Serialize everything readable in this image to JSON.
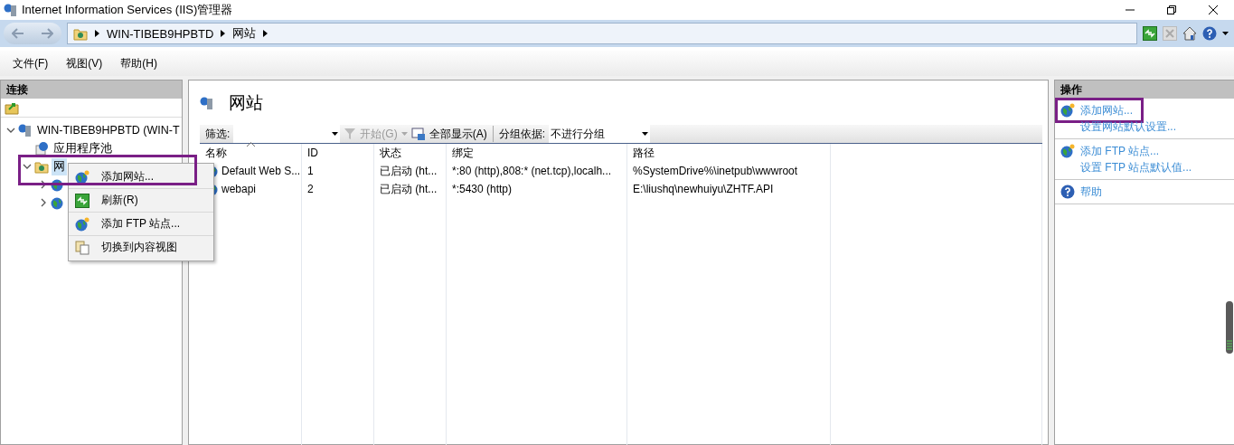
{
  "window": {
    "title": "Internet Information Services (IIS)管理器"
  },
  "address_bar": {
    "segments": [
      "WIN-TIBEB9HPBTD",
      "网站"
    ]
  },
  "menu_bar": [
    "文件(F)",
    "视图(V)",
    "帮助(H)"
  ],
  "connections": {
    "title": "连接",
    "tree": [
      {
        "label": "WIN-TIBEB9HPBTD (WIN-T",
        "kind": "server",
        "expanded": true,
        "selected": false,
        "children": [
          {
            "label": "应用程序池",
            "kind": "pool",
            "selected": false
          },
          {
            "label": "网",
            "kind": "folder",
            "expanded": true,
            "selected": true,
            "children": [
              {
                "kind": "site",
                "expanded": false
              },
              {
                "kind": "site",
                "expanded": false
              }
            ]
          }
        ]
      }
    ]
  },
  "context_menu": {
    "items": [
      {
        "label": "添加网站...",
        "kind": "add",
        "highlighted": true
      },
      {
        "label": "刷新(R)",
        "kind": "refresh",
        "highlighted": false
      },
      {
        "label": "添加 FTP 站点...",
        "kind": "add",
        "highlighted": false
      },
      {
        "label": "切换到内容视图",
        "kind": "content",
        "highlighted": false
      }
    ]
  },
  "page": {
    "title": "网站",
    "filter": {
      "label": "筛选:",
      "start": "开始(G)",
      "show_all": "全部显示(A)",
      "group_label": "分组依据:",
      "group_value": "不进行分组"
    },
    "table": {
      "columns": [
        "名称",
        "ID",
        "状态",
        "绑定",
        "路径"
      ],
      "rows": [
        {
          "cells": [
            "Default Web S...",
            "1",
            "已启动 (ht...",
            "*:80 (http),808:* (net.tcp),localh...",
            "%SystemDrive%\\inetpub\\wwwroot"
          ]
        },
        {
          "cells": [
            "webapi",
            "2",
            "已启动 (ht...",
            "*:5430 (http)",
            "E:\\liushq\\newhuiyu\\ZHTF.API"
          ]
        }
      ]
    }
  },
  "actions": {
    "title": "操作",
    "groups": [
      {
        "items": [
          {
            "label": "添加网站...",
            "kind": "add",
            "highlighted": true
          },
          {
            "label": "设置网站默认设置...",
            "kind": "setting",
            "highlighted": false
          }
        ]
      },
      {
        "items": [
          {
            "label": "添加 FTP 站点...",
            "kind": "add",
            "highlighted": false
          },
          {
            "label": "设置 FTP 站点默认值...",
            "kind": "setting",
            "highlighted": false
          }
        ]
      },
      {
        "items": [
          {
            "label": "帮助",
            "kind": "help",
            "highlighted": false
          }
        ]
      }
    ]
  }
}
